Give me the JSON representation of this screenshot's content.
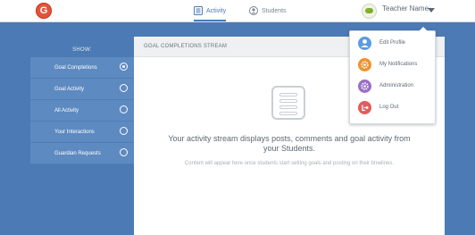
{
  "app": {
    "logo_letter": "G"
  },
  "nav": {
    "activity_label": "Activity",
    "students_label": "Students"
  },
  "user": {
    "name": "Teacher Name"
  },
  "sidebar": {
    "heading": "SHOW:",
    "items": [
      {
        "label": "Goal Completions",
        "selected": true
      },
      {
        "label": "Goal Activity",
        "selected": false
      },
      {
        "label": "All Activity",
        "selected": false
      },
      {
        "label": "Your Interactions",
        "selected": false
      },
      {
        "label": "Guardian Requests",
        "selected": false
      }
    ]
  },
  "panel": {
    "title": "GOAL COMPLETIONS STREAM",
    "empty_title": "Your activity stream displays posts, comments and goal activity from your Students.",
    "empty_subtitle": "Content will appear here once students start setting goals and posting on their timelines."
  },
  "dropdown": {
    "items": [
      {
        "label": "Edit Profile",
        "icon": "user-icon",
        "color": "#5b9be0"
      },
      {
        "label": "My Notifications",
        "icon": "gear-icon",
        "color": "#f0922b"
      },
      {
        "label": "Administration",
        "icon": "gear-icon",
        "color": "#9b6fc6"
      },
      {
        "label": "Log Out",
        "icon": "logout-icon",
        "color": "#e25c5c"
      }
    ]
  },
  "colors": {
    "background": "#4b7ab4",
    "sidebar_item": "#5d8ac0",
    "accent": "#4b7ab4"
  }
}
